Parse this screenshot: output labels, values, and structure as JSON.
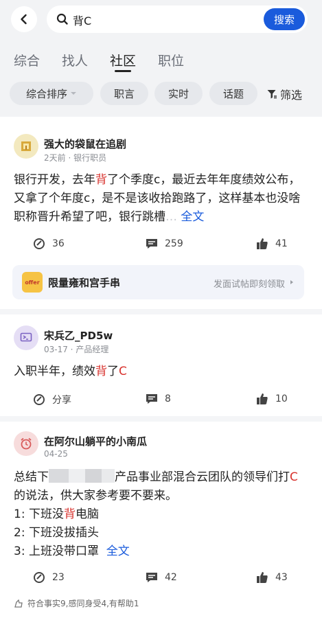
{
  "search": {
    "query": "背C",
    "button_label": "搜索"
  },
  "tabs": [
    {
      "label": "综合",
      "active": false
    },
    {
      "label": "找人",
      "active": false
    },
    {
      "label": "社区",
      "active": true
    },
    {
      "label": "职位",
      "active": false
    }
  ],
  "filters": {
    "sort_label": "综合排序",
    "chips": [
      "职言",
      "实时",
      "话题"
    ],
    "filter_label": "筛选"
  },
  "posts": [
    {
      "author": "强大的袋鼠在追剧",
      "meta": "2天前 · 银行职员",
      "body_parts": [
        "银行开发，去年",
        "背",
        "了个季度c，最近去年年度绩效公布，又拿了个年度c，是不是该收拾跑路了，这样基本也没啥职称晋升希望了吧，银行跳槽",
        "全文"
      ],
      "actions": {
        "share": "36",
        "comments": "259",
        "likes": "41"
      }
    },
    {
      "author": "宋兵乙_PD5w",
      "meta": "03-17 · 产品经理",
      "body_parts": [
        "入职半年，绩效",
        "背",
        "了",
        "C"
      ],
      "actions": {
        "share": "分享",
        "comments": "8",
        "likes": "10"
      }
    },
    {
      "author": "在阿尔山躺平的小南瓜",
      "meta": "04-25",
      "body_parts": [
        "总结下",
        "产品事业部混合云团队的领导们打",
        "C",
        "的说法，供大家参考要不要来。"
      ],
      "lines": [
        {
          "prefix": "1:  下班没",
          "hl": "背",
          "suffix": "电脑"
        },
        {
          "prefix": "2:  下班没拔插头",
          "hl": "",
          "suffix": ""
        },
        {
          "prefix": "3:  上班没带口罩",
          "hl": "",
          "suffix": ""
        }
      ],
      "more": "全文",
      "actions": {
        "share": "23",
        "comments": "42",
        "likes": "43"
      },
      "footer": "符合事实9,感同身受4,有帮助1"
    }
  ],
  "promo": {
    "title": "限量雍和宫手串",
    "cta": "发面试帖即刻领取",
    "icon_text": "offer"
  }
}
